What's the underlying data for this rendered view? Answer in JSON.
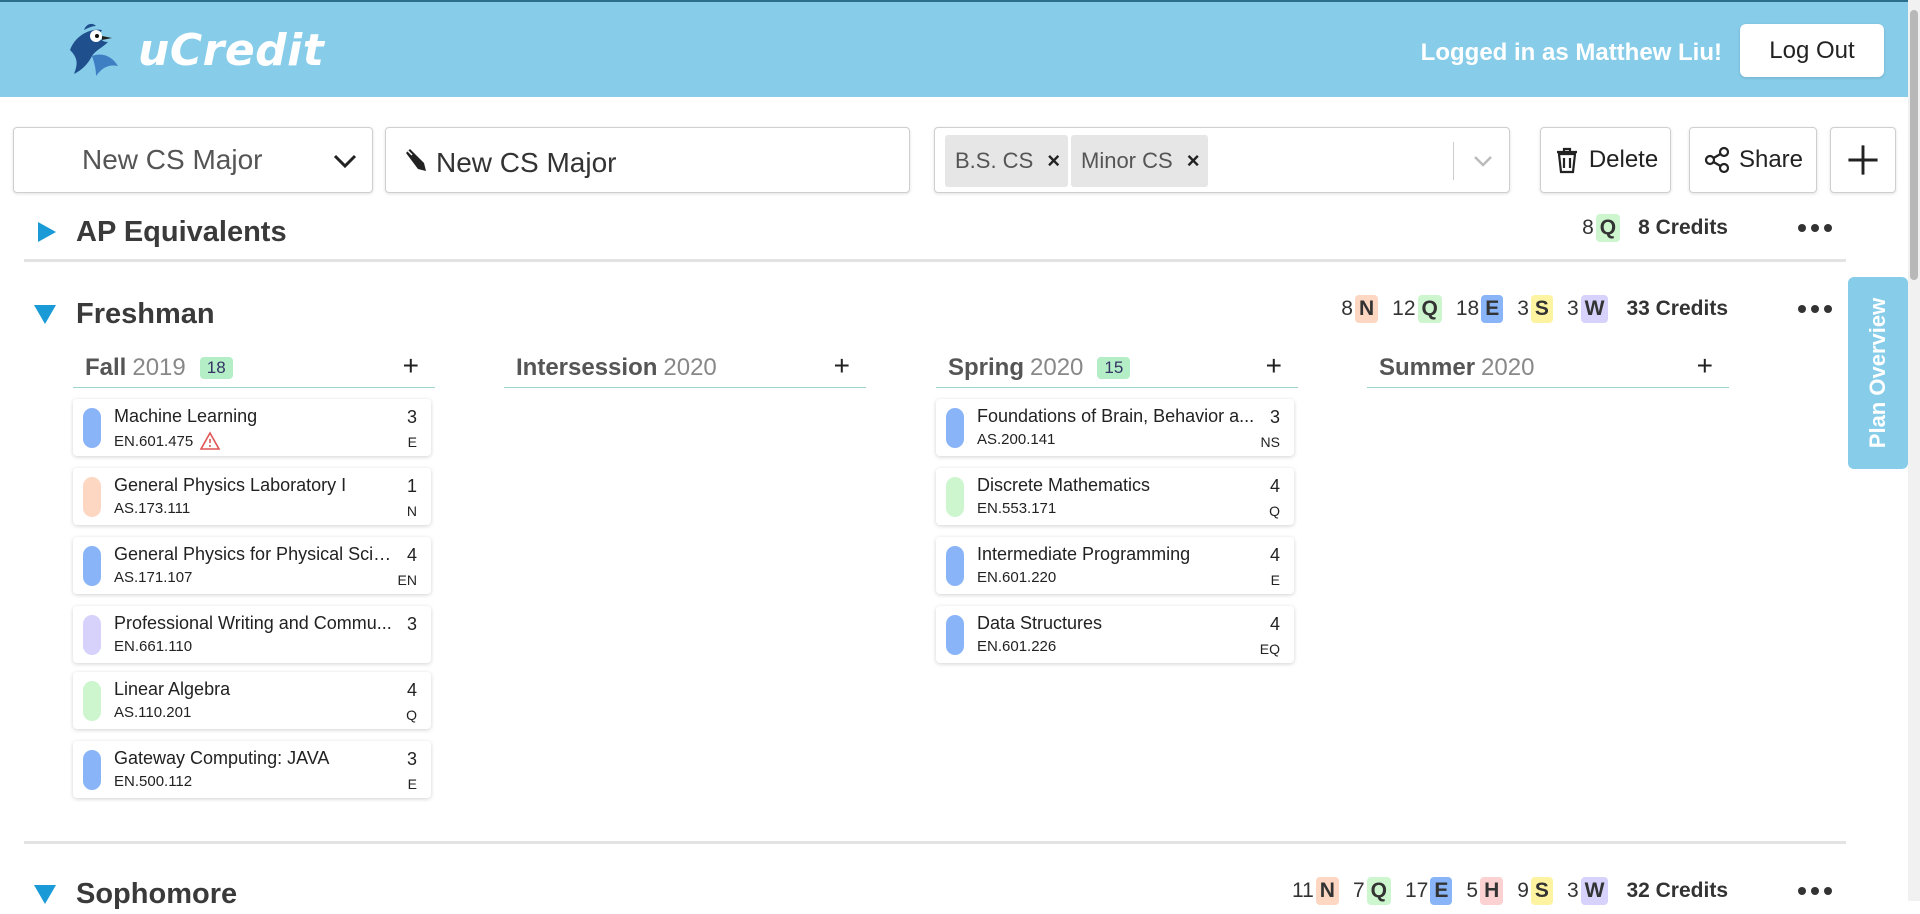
{
  "header": {
    "app_name": "uCredit",
    "logged_in_text": "Logged in as Matthew Liu!",
    "logout_label": "Log Out",
    "brand_color": "#87cdea"
  },
  "toolbar": {
    "plan_select_value": "New CS Major",
    "plan_name_value": "New CS Major",
    "majors": [
      "B.S. CS",
      "Minor CS"
    ],
    "delete_label": "Delete",
    "share_label": "Share"
  },
  "years": {
    "ap": {
      "name": "AP Equivalents",
      "stats": [
        {
          "count": "8",
          "area": "Q"
        }
      ],
      "credits": "8 Credits"
    },
    "freshman": {
      "name": "Freshman",
      "stats": [
        {
          "count": "8",
          "area": "N"
        },
        {
          "count": "12",
          "area": "Q"
        },
        {
          "count": "18",
          "area": "E"
        },
        {
          "count": "3",
          "area": "S"
        },
        {
          "count": "3",
          "area": "W"
        }
      ],
      "credits": "33 Credits",
      "semesters": [
        {
          "term": "Fall",
          "year": "2019",
          "count": "18",
          "courses": [
            {
              "title": "Machine Learning",
              "number": "EN.601.475",
              "credits": "3",
              "area": "E",
              "color": "#8ab4f8",
              "warning": true
            },
            {
              "title": "General Physics Laboratory I",
              "number": "AS.173.111",
              "credits": "1",
              "area": "N",
              "color": "#fdd7c2"
            },
            {
              "title": "General Physics for Physical Scien...",
              "number": "AS.171.107",
              "credits": "4",
              "area": "EN",
              "color": "#8ab4f8"
            },
            {
              "title": "Professional Writing and Commu...",
              "number": "EN.661.110",
              "credits": "3",
              "area": "",
              "color": "#d6d2fb"
            },
            {
              "title": "Linear Algebra",
              "number": "AS.110.201",
              "credits": "4",
              "area": "Q",
              "color": "#cdf6cf"
            },
            {
              "title": "Gateway Computing: JAVA",
              "number": "EN.500.112",
              "credits": "3",
              "area": "E",
              "color": "#8ab4f8"
            }
          ]
        },
        {
          "term": "Intersession",
          "year": "2020",
          "count": "",
          "courses": []
        },
        {
          "term": "Spring",
          "year": "2020",
          "count": "15",
          "courses": [
            {
              "title": "Foundations of Brain, Behavior a...",
              "number": "AS.200.141",
              "credits": "3",
              "area": "NS",
              "color": "#8ab4f8"
            },
            {
              "title": "Discrete Mathematics",
              "number": "EN.553.171",
              "credits": "4",
              "area": "Q",
              "color": "#cdf6cf"
            },
            {
              "title": "Intermediate Programming",
              "number": "EN.601.220",
              "credits": "4",
              "area": "E",
              "color": "#8ab4f8"
            },
            {
              "title": "Data Structures",
              "number": "EN.601.226",
              "credits": "4",
              "area": "EQ",
              "color": "#8ab4f8"
            }
          ]
        },
        {
          "term": "Summer",
          "year": "2020",
          "count": "",
          "courses": []
        }
      ]
    },
    "sophomore": {
      "name": "Sophomore",
      "stats": [
        {
          "count": "11",
          "area": "N"
        },
        {
          "count": "7",
          "area": "Q"
        },
        {
          "count": "17",
          "area": "E"
        },
        {
          "count": "5",
          "area": "H"
        },
        {
          "count": "9",
          "area": "S"
        },
        {
          "count": "3",
          "area": "W"
        }
      ],
      "credits": "32 Credits"
    }
  },
  "area_colors": {
    "N": "#fdd7c2",
    "Q": "#cdf6cf",
    "E": "#8ab4f8",
    "S": "#fef3a0",
    "W": "#d6d2fb",
    "H": "#fbd1d1"
  },
  "overview_tab_label": "Plan Overview",
  "icons": {
    "logo": "bluejay-logo",
    "chevron": "chevron-down-icon",
    "pencil": "pencil-icon",
    "delete": "trash-icon",
    "share": "share-icon",
    "add": "plus-icon",
    "warning": "warning-icon"
  }
}
